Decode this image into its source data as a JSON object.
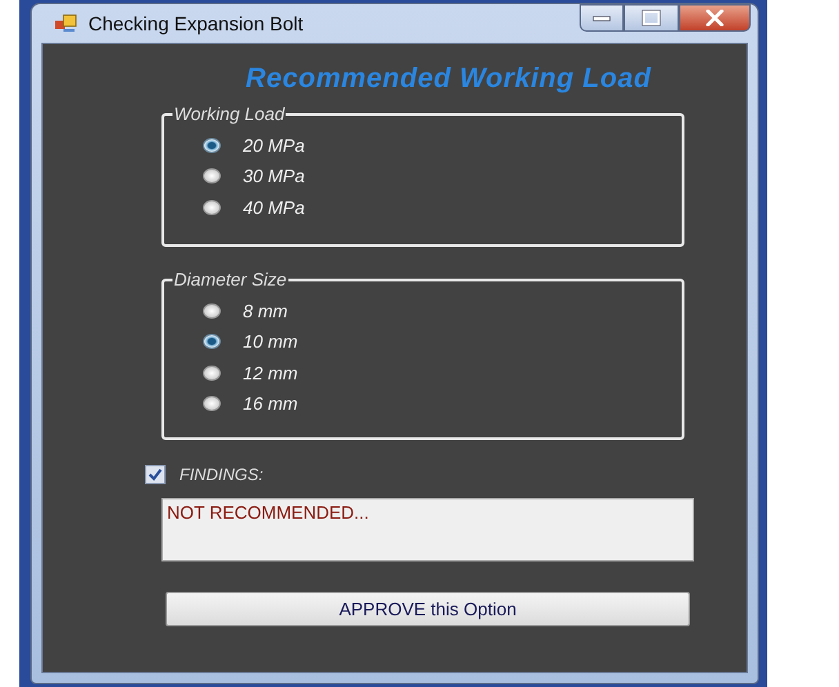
{
  "window": {
    "title": "Checking Expansion Bolt"
  },
  "heading": "Recommended Working Load",
  "groups": [
    {
      "label": "Working Load",
      "options": [
        {
          "label": "20 MPa",
          "selected": true
        },
        {
          "label": "30 MPa",
          "selected": false
        },
        {
          "label": "40 MPa",
          "selected": false
        }
      ]
    },
    {
      "label": "Diameter Size",
      "options": [
        {
          "label": "8 mm",
          "selected": false
        },
        {
          "label": "10 mm",
          "selected": true
        },
        {
          "label": "12 mm",
          "selected": false
        },
        {
          "label": "16 mm",
          "selected": false
        }
      ]
    }
  ],
  "findings": {
    "label": "FINDINGS:",
    "checked": true,
    "value": "NOT RECOMMENDED..."
  },
  "button": "APPROVE this Option"
}
